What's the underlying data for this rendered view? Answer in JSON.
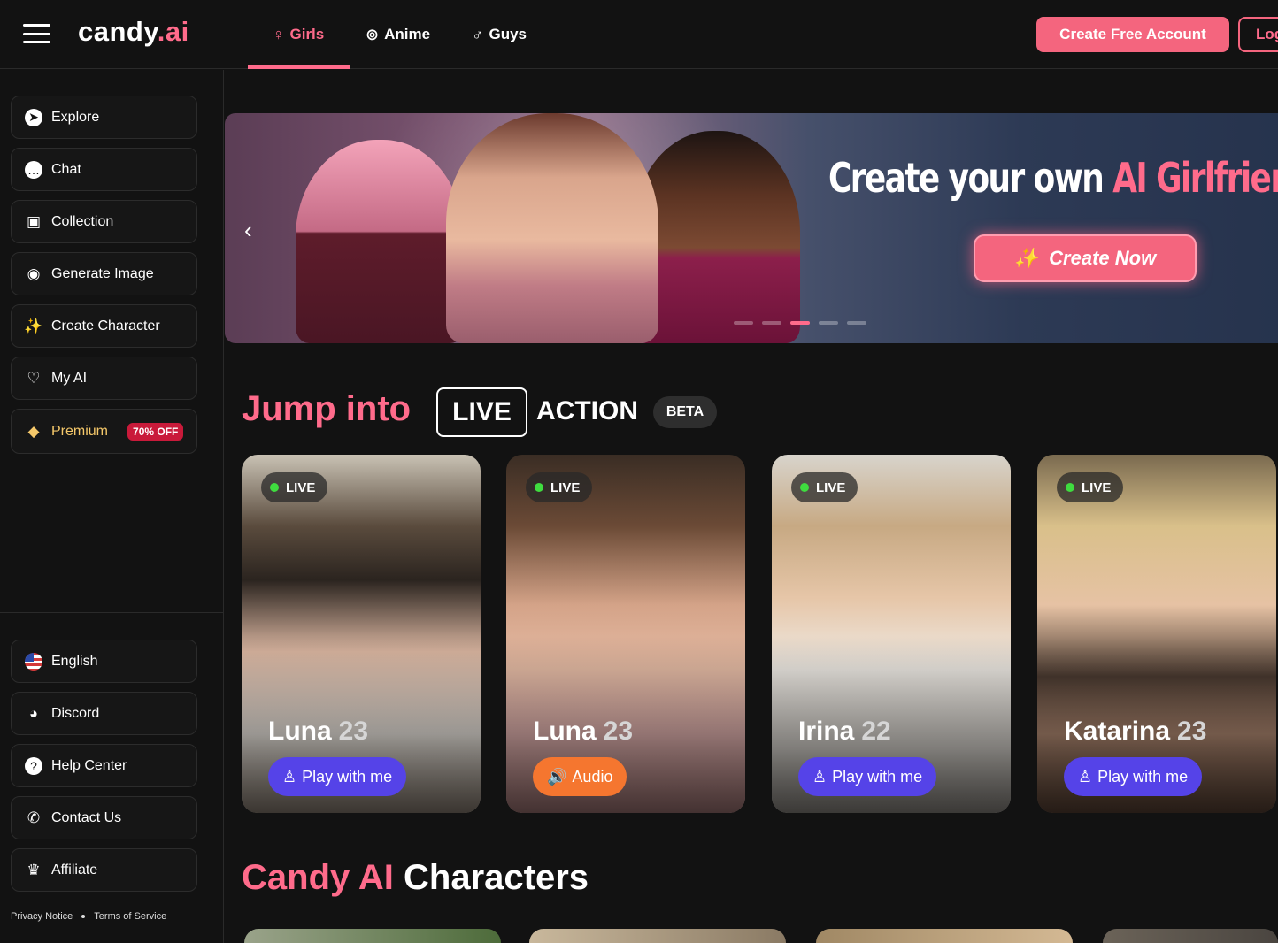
{
  "brand": {
    "name_main": "candy",
    "name_dot": ".ai"
  },
  "nav": {
    "tabs": [
      {
        "label": "Girls",
        "icon": "female-icon"
      },
      {
        "label": "Anime",
        "icon": "anime-icon"
      },
      {
        "label": "Guys",
        "icon": "male-icon"
      }
    ],
    "active_tab": "Girls",
    "create_account": "Create Free Account",
    "login": "Login"
  },
  "sidebar": {
    "items": [
      {
        "label": "Explore",
        "icon": "compass-icon"
      },
      {
        "label": "Chat",
        "icon": "chat-icon"
      },
      {
        "label": "Collection",
        "icon": "gallery-icon"
      },
      {
        "label": "Generate Image",
        "icon": "camera-icon"
      },
      {
        "label": "Create Character",
        "icon": "magic-wand-icon"
      },
      {
        "label": "My AI",
        "icon": "heart-icon"
      }
    ],
    "premium": {
      "label": "Premium",
      "badge": "70% OFF",
      "icon": "diamond-icon"
    },
    "bottom_items": [
      {
        "label": "English",
        "icon": "us-flag-icon"
      },
      {
        "label": "Discord",
        "icon": "discord-icon"
      },
      {
        "label": "Help Center",
        "icon": "help-icon"
      },
      {
        "label": "Contact Us",
        "icon": "contact-icon"
      },
      {
        "label": "Affiliate",
        "icon": "trophy-icon"
      }
    ],
    "footer": {
      "privacy": "Privacy Notice",
      "terms": "Terms of Service"
    }
  },
  "banner": {
    "title_main": "Create your own ",
    "title_highlight": "AI Girlfriend",
    "cta": "Create Now",
    "slide_count": 5,
    "active_slide": 3
  },
  "live_section": {
    "title_prefix": "Jump into",
    "live": "LIVE",
    "action": "ACTION",
    "badge": "BETA",
    "cards": [
      {
        "live_label": "LIVE",
        "name": "Luna",
        "age": "23",
        "button": "Play with me",
        "button_type": "play",
        "button_icon": "joystick-icon"
      },
      {
        "live_label": "LIVE",
        "name": "Luna",
        "age": "23",
        "button": "Audio",
        "button_type": "audio",
        "button_icon": "speaker-icon"
      },
      {
        "live_label": "LIVE",
        "name": "Irina",
        "age": "22",
        "button": "Play with me",
        "button_type": "play",
        "button_icon": "joystick-icon"
      },
      {
        "live_label": "LIVE",
        "name": "Katarina",
        "age": "23",
        "button": "Play with me",
        "button_type": "play",
        "button_icon": "joystick-icon"
      }
    ]
  },
  "characters_section": {
    "title_highlight": "Candy AI",
    "title_rest": "Characters"
  },
  "colors": {
    "accent": "#f4657e",
    "accent_text": "#ff6b8b",
    "play_button": "#5543e8",
    "audio_button": "#f5762f",
    "background": "#121212"
  }
}
